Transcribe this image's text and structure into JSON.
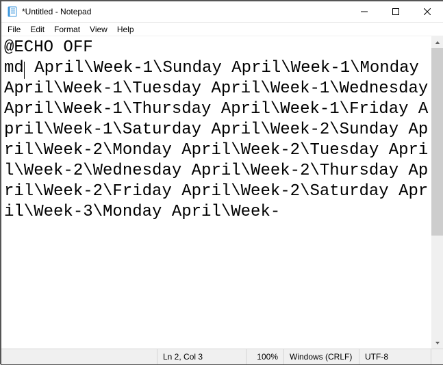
{
  "titlebar": {
    "title": "*Untitled - Notepad"
  },
  "menu": {
    "file": "File",
    "edit": "Edit",
    "format": "Format",
    "view": "View",
    "help": "Help"
  },
  "editor": {
    "line1": "@ECHO OFF",
    "line2_before_caret": "md",
    "line2_after_caret": " April\\Week-1\\Sunday April\\Week-1\\Monday April\\Week-1\\Tuesday April\\Week-1\\Wednesday April\\Week-1\\Thursday April\\Week-1\\Friday April\\Week-1\\Saturday April\\Week-2\\Sunday April\\Week-2\\Monday April\\Week-2\\Tuesday April\\Week-2\\Wednesday April\\Week-2\\Thursday April\\Week-2\\Friday April\\Week-2\\Saturday April\\Week-3\\Monday April\\Week-"
  },
  "status": {
    "lncol": "Ln 2, Col 3",
    "zoom": "100%",
    "eol": "Windows (CRLF)",
    "encoding": "UTF-8"
  }
}
